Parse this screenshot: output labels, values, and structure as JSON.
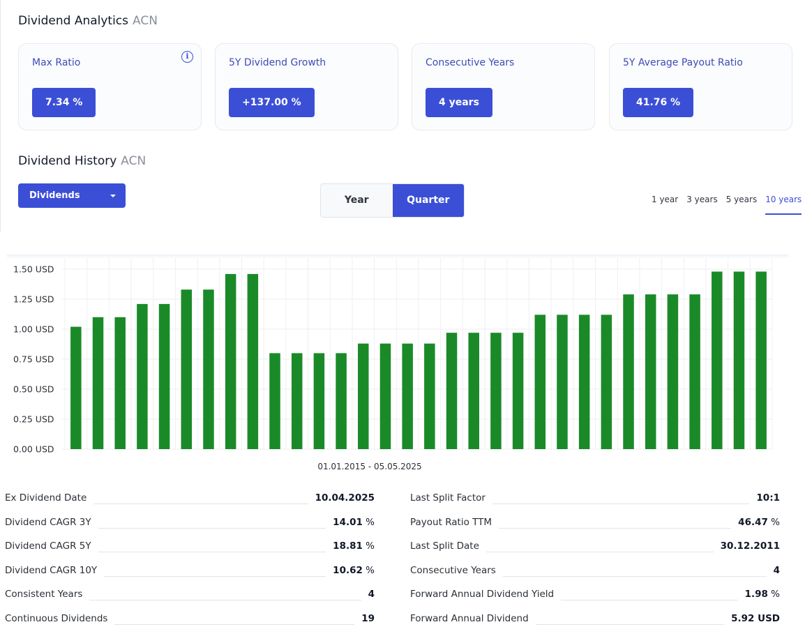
{
  "analytics": {
    "title": "Dividend Analytics",
    "ticker": "ACN",
    "cards": [
      {
        "label": "Max Ratio",
        "value": "7.34 %"
      },
      {
        "label": "5Y Dividend Growth",
        "value": "+137.00 %"
      },
      {
        "label": "Consecutive Years",
        "value": "4 years"
      },
      {
        "label": "5Y Average Payout Ratio",
        "value": "41.76 %"
      }
    ],
    "info_icon": "info-icon"
  },
  "history": {
    "title": "Dividend History",
    "ticker": "ACN",
    "dropdown_value": "Dividends",
    "toggle": {
      "year": "Year",
      "quarter": "Quarter",
      "selected": "Quarter"
    },
    "ranges": [
      "1 year",
      "3 years",
      "5 years",
      "10 years"
    ],
    "active_range": "10 years",
    "accent_color": "#3b4fd6",
    "bar_color": "#1a8a28"
  },
  "chart_data": {
    "type": "bar",
    "date_range_label": "01.01.2015 - 05.05.2025",
    "y_ticks": [
      "0.00 USD",
      "0.25 USD",
      "0.50 USD",
      "0.75 USD",
      "1.00 USD",
      "1.25 USD",
      "1.50 USD"
    ],
    "ylim": [
      0,
      1.5
    ],
    "grid": true,
    "values": [
      1.02,
      1.1,
      1.1,
      1.21,
      1.21,
      1.33,
      1.33,
      1.46,
      1.46,
      0.8,
      0.8,
      0.8,
      0.8,
      0.88,
      0.88,
      0.88,
      0.88,
      0.97,
      0.97,
      0.97,
      0.97,
      1.12,
      1.12,
      1.12,
      1.12,
      1.29,
      1.29,
      1.29,
      1.29,
      1.48,
      1.48,
      1.48
    ]
  },
  "stats_left": [
    {
      "label": "Ex Dividend Date",
      "value": "10.04.2025",
      "unit": ""
    },
    {
      "label": "Dividend CAGR 3Y",
      "value": "14.01",
      "unit": " %"
    },
    {
      "label": "Dividend CAGR 5Y",
      "value": "18.81",
      "unit": " %"
    },
    {
      "label": "Dividend CAGR 10Y",
      "value": "10.62",
      "unit": " %"
    },
    {
      "label": "Consistent Years",
      "value": "4",
      "unit": ""
    },
    {
      "label": "Continuous Dividends",
      "value": "19",
      "unit": ""
    }
  ],
  "stats_right": [
    {
      "label": "Last Split Factor",
      "value": "10:1",
      "unit": ""
    },
    {
      "label": "Payout Ratio TTM",
      "value": "46.47",
      "unit": " %"
    },
    {
      "label": "Last Split Date",
      "value": "30.12.2011",
      "unit": ""
    },
    {
      "label": "Consecutive Years",
      "value": "4",
      "unit": ""
    },
    {
      "label": "Forward Annual Dividend Yield",
      "value": "1.98",
      "unit": " %"
    },
    {
      "label": "Forward Annual Dividend",
      "value": "5.92 USD",
      "unit": ""
    }
  ]
}
